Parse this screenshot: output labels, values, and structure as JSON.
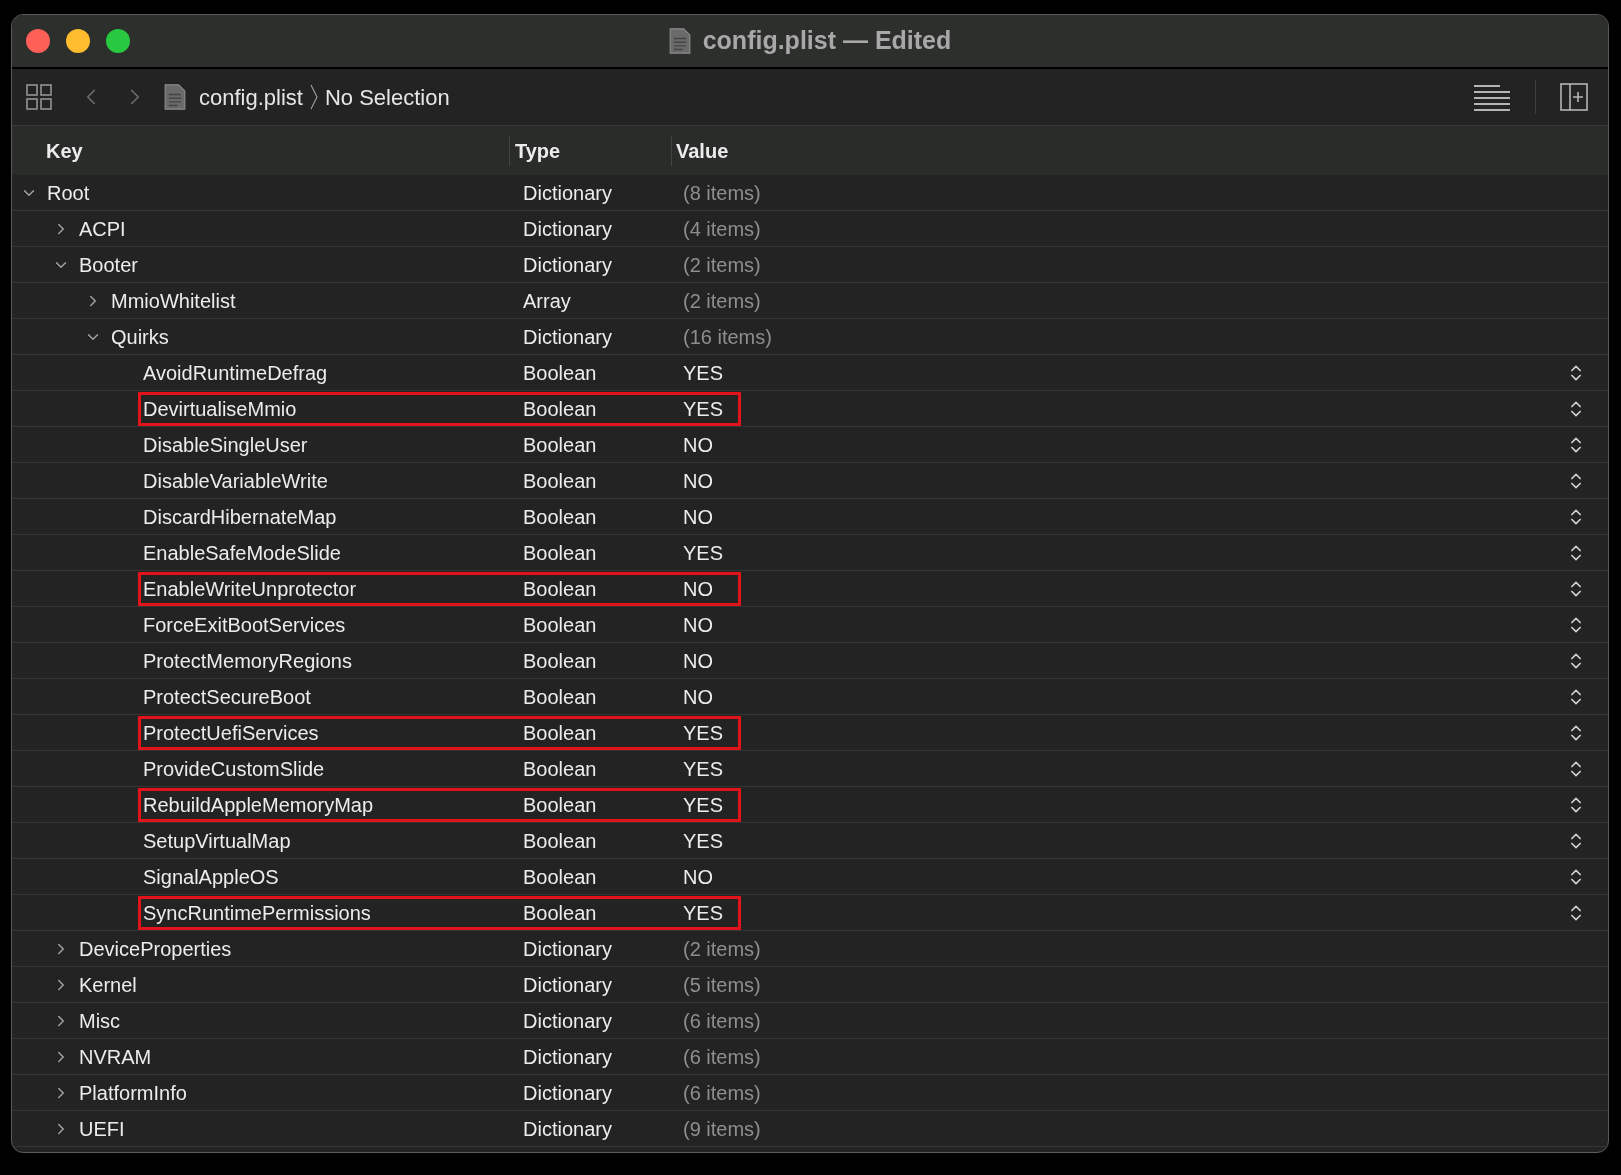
{
  "window": {
    "title": "config.plist — Edited"
  },
  "toolbar": {
    "breadcrumb": [
      "config.plist",
      "No Selection"
    ]
  },
  "columns": [
    "Key",
    "Type",
    "Value"
  ],
  "tree": [
    {
      "key": "Root",
      "type": "Dictionary",
      "value": "(8 items)",
      "kind": "container",
      "expanded": true,
      "children": [
        {
          "key": "ACPI",
          "type": "Dictionary",
          "value": "(4 items)",
          "kind": "container",
          "expanded": false
        },
        {
          "key": "Booter",
          "type": "Dictionary",
          "value": "(2 items)",
          "kind": "container",
          "expanded": true,
          "children": [
            {
              "key": "MmioWhitelist",
              "type": "Array",
              "value": "(2 items)",
              "kind": "container",
              "expanded": false
            },
            {
              "key": "Quirks",
              "type": "Dictionary",
              "value": "(16 items)",
              "kind": "container",
              "expanded": true,
              "children": [
                {
                  "key": "AvoidRuntimeDefrag",
                  "type": "Boolean",
                  "value": "YES",
                  "kind": "boolean",
                  "highlighted": false
                },
                {
                  "key": "DevirtualiseMmio",
                  "type": "Boolean",
                  "value": "YES",
                  "kind": "boolean",
                  "highlighted": true
                },
                {
                  "key": "DisableSingleUser",
                  "type": "Boolean",
                  "value": "NO",
                  "kind": "boolean",
                  "highlighted": false
                },
                {
                  "key": "DisableVariableWrite",
                  "type": "Boolean",
                  "value": "NO",
                  "kind": "boolean",
                  "highlighted": false
                },
                {
                  "key": "DiscardHibernateMap",
                  "type": "Boolean",
                  "value": "NO",
                  "kind": "boolean",
                  "highlighted": false
                },
                {
                  "key": "EnableSafeModeSlide",
                  "type": "Boolean",
                  "value": "YES",
                  "kind": "boolean",
                  "highlighted": false
                },
                {
                  "key": "EnableWriteUnprotector",
                  "type": "Boolean",
                  "value": "NO",
                  "kind": "boolean",
                  "highlighted": true
                },
                {
                  "key": "ForceExitBootServices",
                  "type": "Boolean",
                  "value": "NO",
                  "kind": "boolean",
                  "highlighted": false
                },
                {
                  "key": "ProtectMemoryRegions",
                  "type": "Boolean",
                  "value": "NO",
                  "kind": "boolean",
                  "highlighted": false
                },
                {
                  "key": "ProtectSecureBoot",
                  "type": "Boolean",
                  "value": "NO",
                  "kind": "boolean",
                  "highlighted": false
                },
                {
                  "key": "ProtectUefiServices",
                  "type": "Boolean",
                  "value": "YES",
                  "kind": "boolean",
                  "highlighted": true
                },
                {
                  "key": "ProvideCustomSlide",
                  "type": "Boolean",
                  "value": "YES",
                  "kind": "boolean",
                  "highlighted": false
                },
                {
                  "key": "RebuildAppleMemoryMap",
                  "type": "Boolean",
                  "value": "YES",
                  "kind": "boolean",
                  "highlighted": true
                },
                {
                  "key": "SetupVirtualMap",
                  "type": "Boolean",
                  "value": "YES",
                  "kind": "boolean",
                  "highlighted": false
                },
                {
                  "key": "SignalAppleOS",
                  "type": "Boolean",
                  "value": "NO",
                  "kind": "boolean",
                  "highlighted": false
                },
                {
                  "key": "SyncRuntimePermissions",
                  "type": "Boolean",
                  "value": "YES",
                  "kind": "boolean",
                  "highlighted": true
                }
              ]
            }
          ]
        },
        {
          "key": "DeviceProperties",
          "type": "Dictionary",
          "value": "(2 items)",
          "kind": "container",
          "expanded": false
        },
        {
          "key": "Kernel",
          "type": "Dictionary",
          "value": "(5 items)",
          "kind": "container",
          "expanded": false
        },
        {
          "key": "Misc",
          "type": "Dictionary",
          "value": "(6 items)",
          "kind": "container",
          "expanded": false
        },
        {
          "key": "NVRAM",
          "type": "Dictionary",
          "value": "(6 items)",
          "kind": "container",
          "expanded": false
        },
        {
          "key": "PlatformInfo",
          "type": "Dictionary",
          "value": "(6 items)",
          "kind": "container",
          "expanded": false
        },
        {
          "key": "UEFI",
          "type": "Dictionary",
          "value": "(9 items)",
          "kind": "container",
          "expanded": false
        }
      ]
    }
  ]
}
